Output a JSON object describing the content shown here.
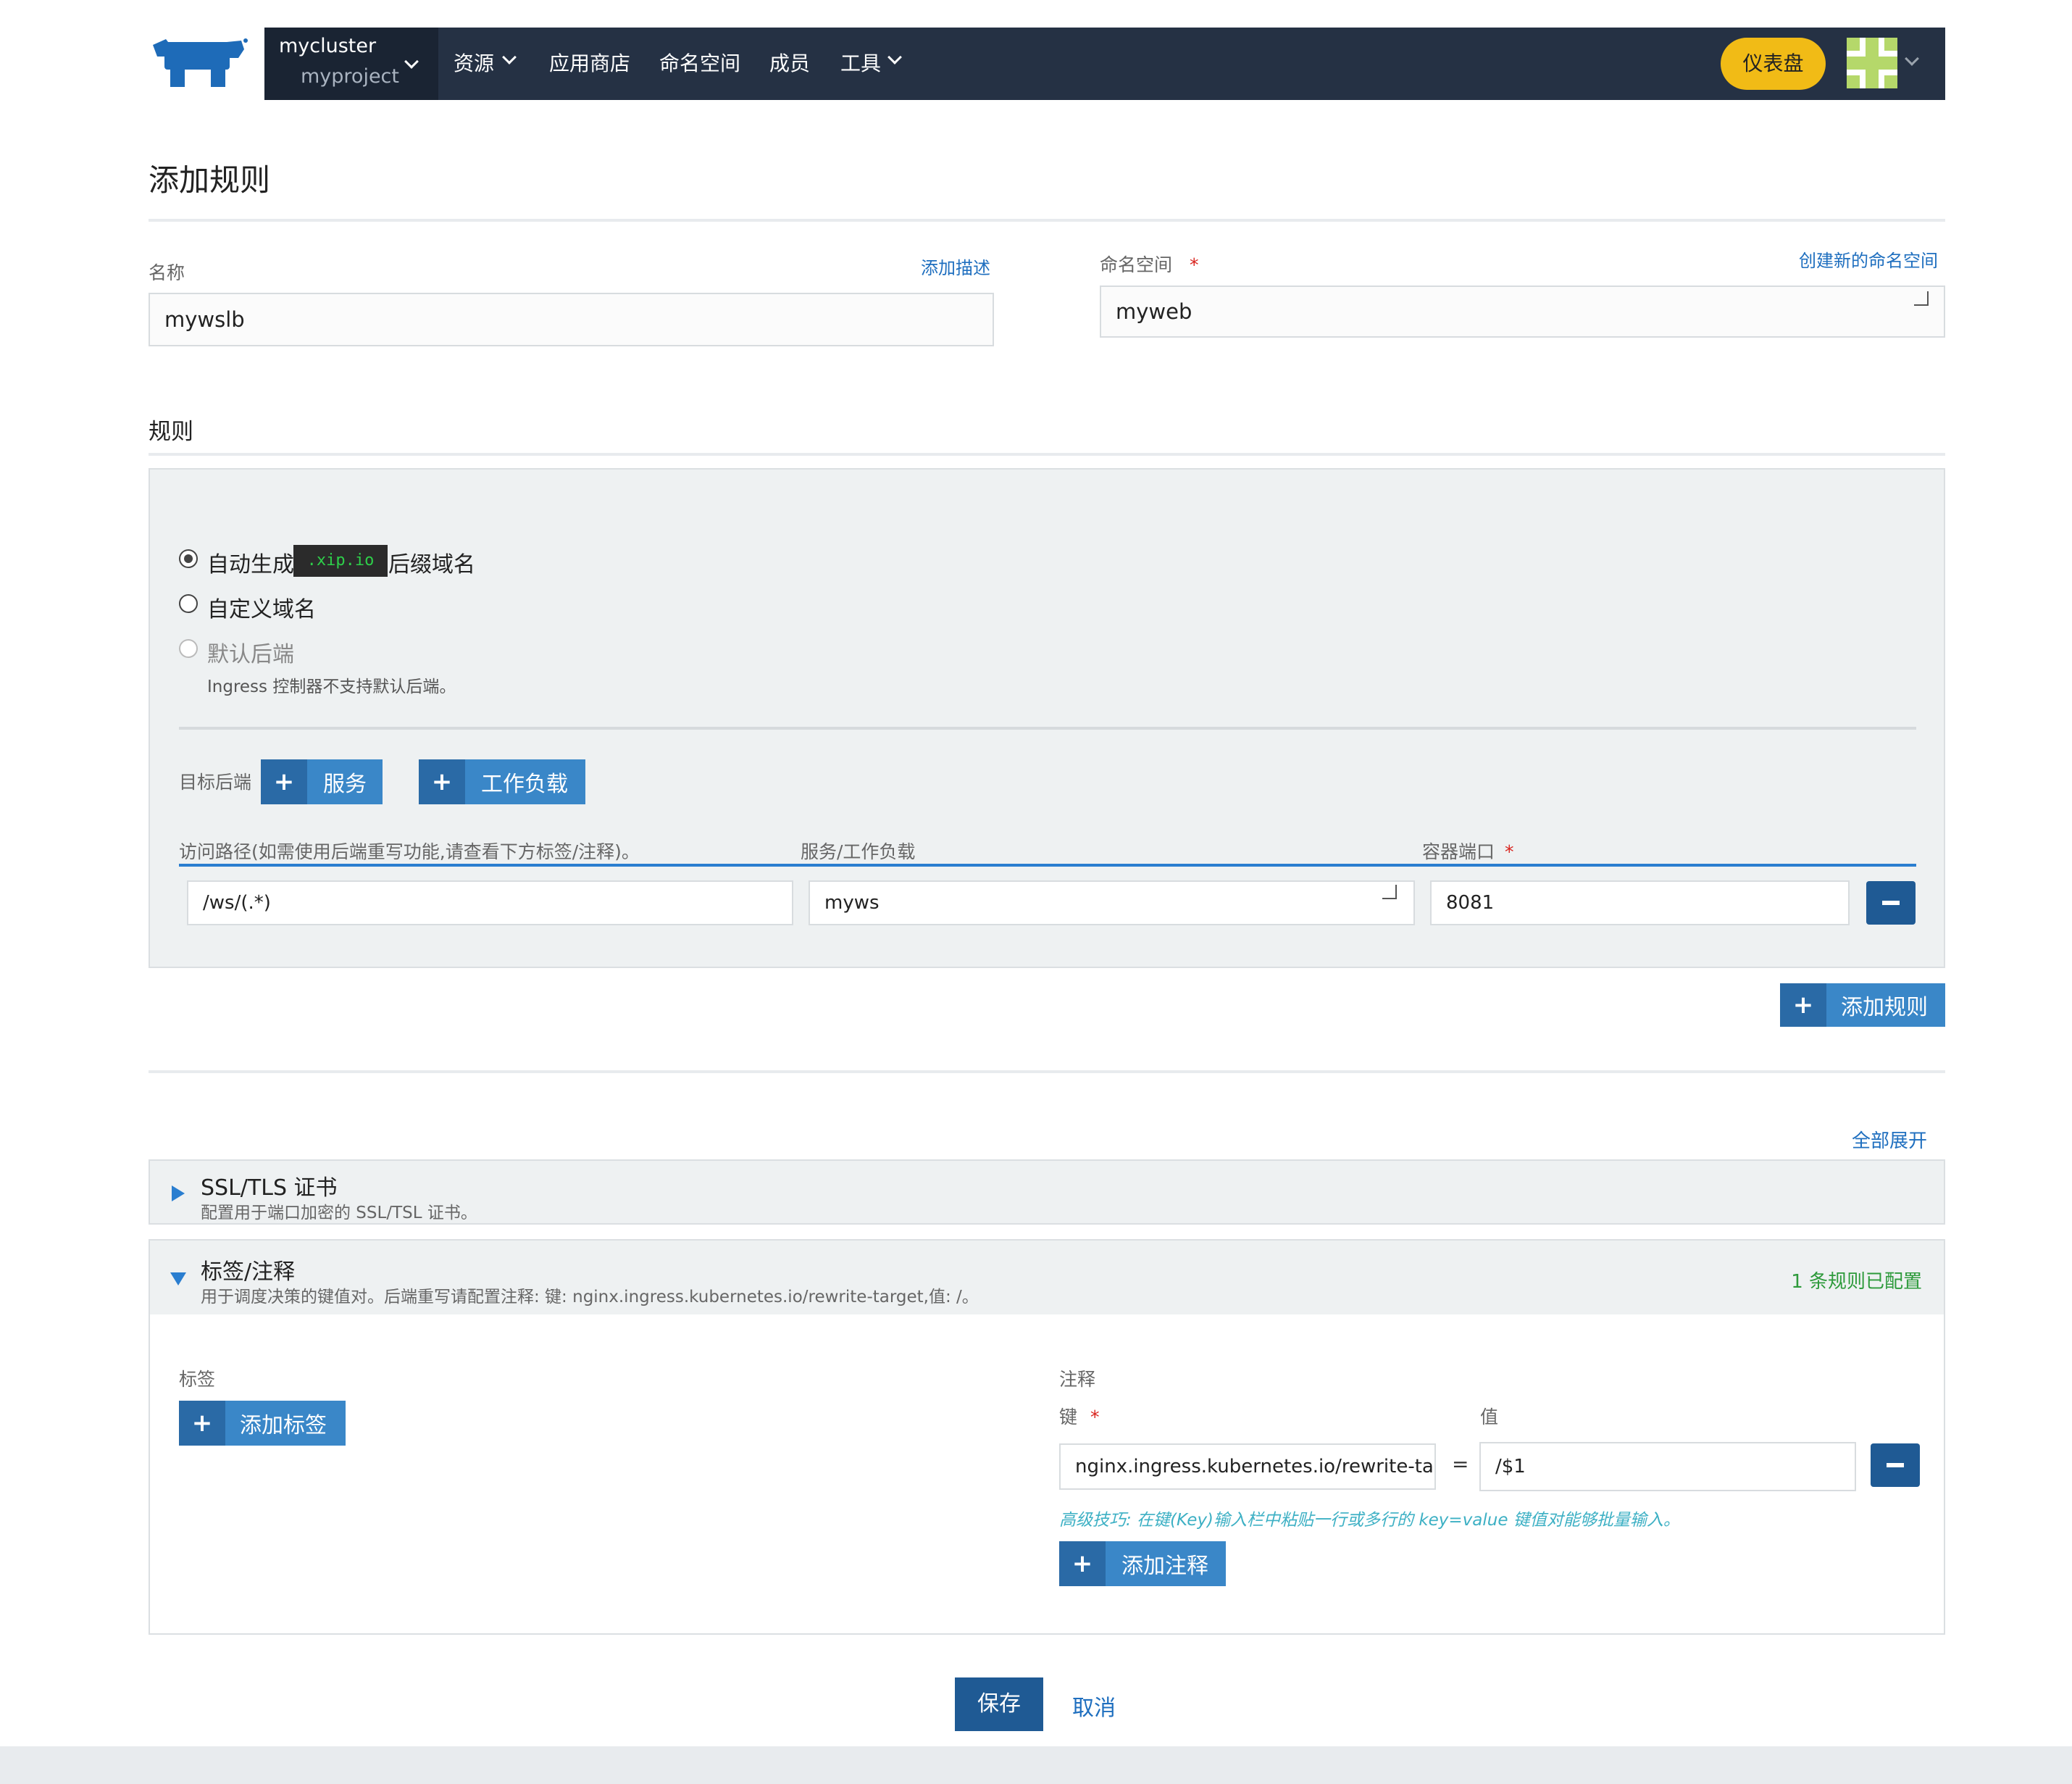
{
  "header": {
    "cluster": "mycluster",
    "project": "myproject",
    "nav": [
      "资源",
      "应用商店",
      "命名空间",
      "成员",
      "工具"
    ],
    "dashboard_button": "仪表盘",
    "logo_icon": "rancher-cow-icon",
    "avatar_icon": "identicon-avatar",
    "colors": {
      "header_bg": "#253144",
      "accent": "#f1bb16",
      "primary": "#3a87c8"
    }
  },
  "page": {
    "title": "添加规则"
  },
  "form": {
    "name_label": "名称",
    "name_value": "mywslb",
    "add_description": "添加描述",
    "namespace_label": "命名空间",
    "required_mark": "*",
    "create_namespace": "创建新的命名空间",
    "namespace_value": "myweb"
  },
  "rules": {
    "section_title": "规则",
    "radio_auto_prefix": "自动生成",
    "radio_auto_code": ".xip.io",
    "radio_auto_suffix": "后缀域名",
    "radio_custom": "自定义域名",
    "radio_default": "默认后端",
    "default_note": "Ingress 控制器不支持默认后端。",
    "target_label": "目标后端",
    "btn_service": "服务",
    "btn_workload": "工作负载",
    "col_path": "访问路径(如需使用后端重写功能,请查看下方标签/注释)。",
    "col_service": "服务/工作负载",
    "col_port": "容器端口",
    "row": {
      "path": "/ws/(.*)",
      "service": "myws",
      "port": "8081"
    },
    "add_rule": "添加规则"
  },
  "accordion": {
    "expand_all": "全部展开",
    "ssl_title": "SSL/TLS 证书",
    "ssl_sub": "配置用于端口加密的 SSL/TSL 证书。",
    "labels_title": "标签/注释",
    "labels_sub": "用于调度决策的键值对。后端重写请配置注释: 键: nginx.ingress.kubernetes.io/rewrite-target,值: /。",
    "labels_status": "1 条规则已配置",
    "labels_label": "标签",
    "add_label": "添加标签",
    "annotations_label": "注释",
    "key_label": "键",
    "value_label": "值",
    "annotation_key": "nginx.ingress.kubernetes.io/rewrite-tar",
    "equals": "=",
    "annotation_value": "/$1",
    "tip": "高级技巧: 在键(Key)输入栏中粘贴一行或多行的 key=value 键值对能够批量输入。",
    "add_annotation": "添加注释"
  },
  "actions": {
    "save": "保存",
    "cancel": "取消"
  }
}
